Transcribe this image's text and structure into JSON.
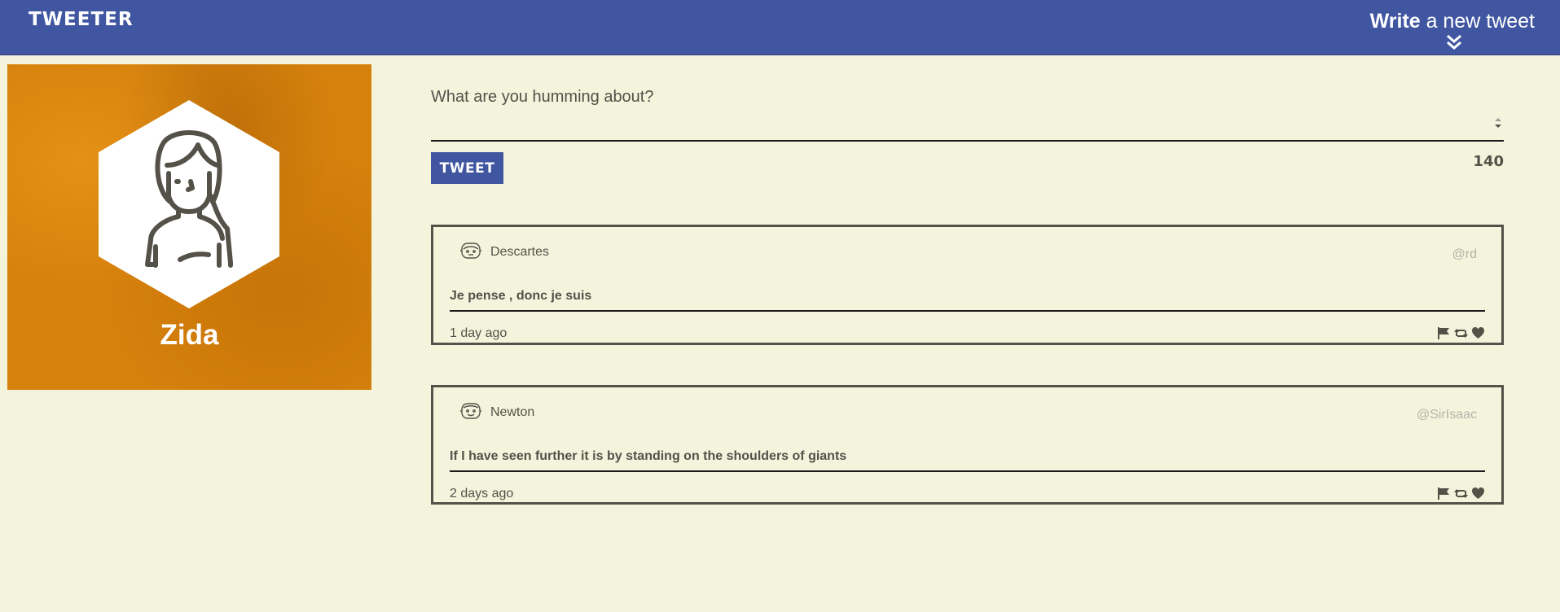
{
  "navbar": {
    "brand": "TWEETER",
    "compose_bold": "Write",
    "compose_rest": " a new tweet",
    "icon": "double-chevron-down-icon"
  },
  "profile": {
    "name": "Zida",
    "avatar_icon": "woman-avatar-icon",
    "background_color": "#d6810c"
  },
  "composer": {
    "placeholder": "What are you humming about?",
    "value": "",
    "button_label": "TWEET",
    "counter": "140"
  },
  "tweets": [
    {
      "author": "Descartes",
      "handle": "@rd",
      "content": "Je pense , donc je suis",
      "time": "1 day ago",
      "avatar_icon": "face-avatar-icon"
    },
    {
      "author": "Newton",
      "handle": "@SirIsaac",
      "content": "If I have seen further it is by standing on the shoulders of giants",
      "time": "2 days ago",
      "avatar_icon": "face-avatar-icon"
    }
  ],
  "tweet_actions": [
    "flag-icon",
    "retweet-icon",
    "heart-icon"
  ],
  "colors": {
    "navbar": "#4056a1",
    "background": "#f4f4dc",
    "text": "#545149",
    "handle": "#b5b3a9"
  }
}
